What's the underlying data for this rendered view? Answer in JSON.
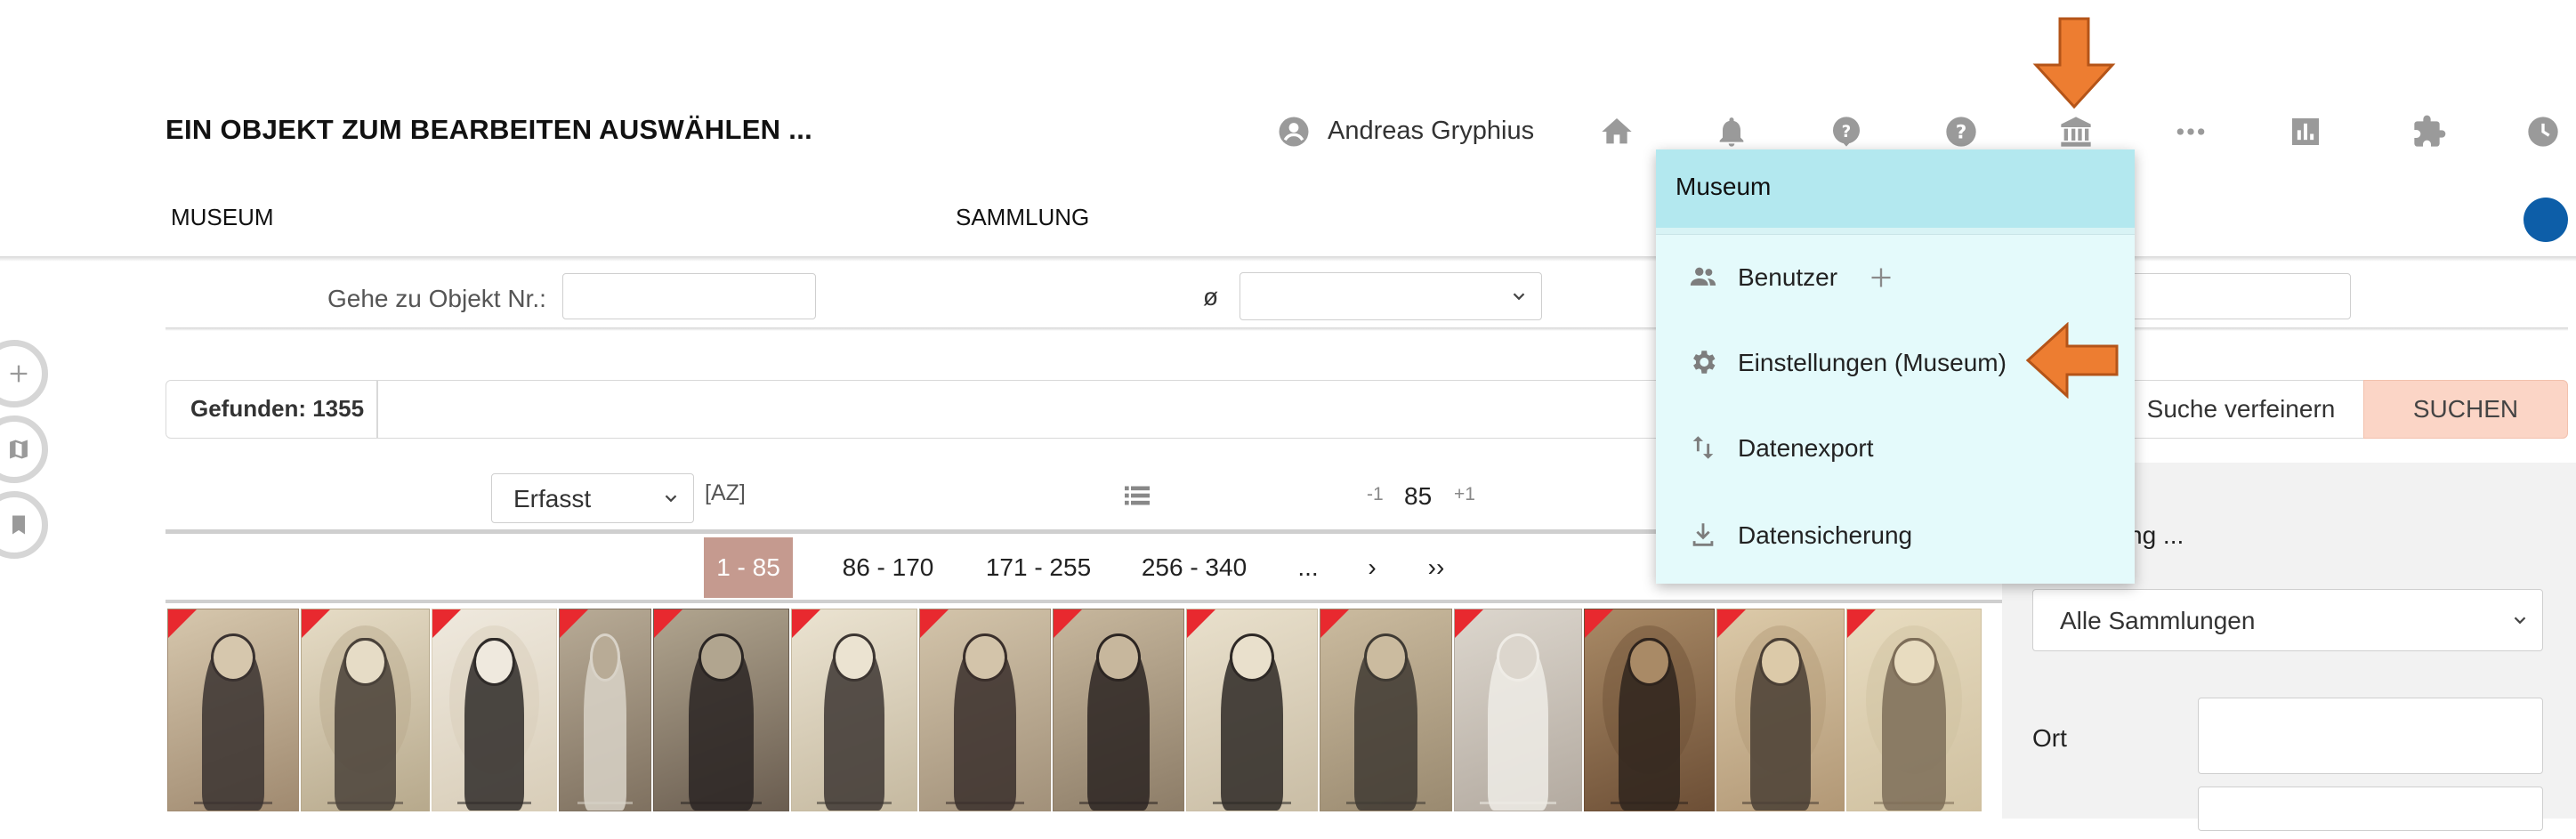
{
  "header": {
    "title": "EIN OBJEKT ZUM BEARBEITEN AUSWÄHLEN ...",
    "user_name": "Andreas Gryphius"
  },
  "tabs": [
    {
      "label": "MUSEUM"
    },
    {
      "label": "SAMMLUNG"
    }
  ],
  "filters": {
    "goto_label": "Gehe zu Objekt Nr.:",
    "goto_value": "",
    "diameter_symbol": "ø",
    "diameter_value": ""
  },
  "results": {
    "found_label": "Gefunden: 1355",
    "refine_label": "Suche verfeinern",
    "search_label": "SUCHEN"
  },
  "sort": {
    "selected": "Erfasst",
    "az_label": "[AZ]",
    "page_minus": "-1",
    "page_size": "85",
    "page_plus": "+1"
  },
  "pagination": [
    {
      "label": "1 - 85",
      "active": true
    },
    {
      "label": "86 - 170"
    },
    {
      "label": "171 - 255"
    },
    {
      "label": "256 - 340"
    },
    {
      "label": "..."
    },
    {
      "label": "›"
    },
    {
      "label": "››"
    }
  ],
  "thumbnails": [
    {
      "tone": "#a08a70",
      "bg": "#d6c7ad",
      "figure": "#3a3230",
      "oval": false
    },
    {
      "tone": "#b7a98c",
      "bg": "#e6dcc6",
      "figure": "#4a423a",
      "oval": true
    },
    {
      "tone": "#d8cdb8",
      "bg": "#efe9de",
      "figure": "#2f2b29",
      "oval": true
    },
    {
      "tone": "#7f7160",
      "bg": "#b8ab96",
      "figure": "#d9d3c8",
      "oval": false
    },
    {
      "tone": "#6a5d50",
      "bg": "#b1a58f",
      "figure": "#2a2523",
      "oval": false
    },
    {
      "tone": "#c5b9a0",
      "bg": "#ebe3d1",
      "figure": "#3d3632",
      "oval": false
    },
    {
      "tone": "#a2917a",
      "bg": "#d3c4aa",
      "figure": "#3a2f2b",
      "oval": false
    },
    {
      "tone": "#8d7d68",
      "bg": "#c7b79d",
      "figure": "#2c2522",
      "oval": false
    },
    {
      "tone": "#c9bda5",
      "bg": "#e9e0cc",
      "figure": "#2e2926",
      "oval": false
    },
    {
      "tone": "#9a8a70",
      "bg": "#cbbb9f",
      "figure": "#3f3a33",
      "oval": false
    },
    {
      "tone": "#b3aaa0",
      "bg": "#dcd6cd",
      "figure": "#efece6",
      "oval": false
    },
    {
      "tone": "#6d4f36",
      "bg": "#a98a66",
      "figure": "#2f241d",
      "oval": true
    },
    {
      "tone": "#b29876",
      "bg": "#dccaa9",
      "figure": "#4a3f35",
      "oval": true
    },
    {
      "tone": "#cfc0a0",
      "bg": "#e8dcc0",
      "figure": "#7d6d58",
      "oval": true
    }
  ],
  "right_panel": {
    "heading_partial": "ng ...",
    "collection_select": "Alle Sammlungen",
    "ort_label": "Ort",
    "ort_value": ""
  },
  "menu": {
    "title": "Museum",
    "items": [
      {
        "label": "Benutzer",
        "icon": "people-icon"
      },
      {
        "label": "Einstellungen (Museum)",
        "icon": "gear-icon"
      },
      {
        "label": "Datenexport",
        "icon": "swap-vertical-icon"
      },
      {
        "label": "Datensicherung",
        "icon": "download-icon"
      }
    ]
  },
  "colors": {
    "accent_orange": "#ED7D31",
    "menu_header": "#b3e8ef",
    "menu_body": "#e4fafb",
    "active_page": "#c59a8f",
    "search_button": "#fbd5c6",
    "thumbnail_flag": "#e8292f"
  }
}
